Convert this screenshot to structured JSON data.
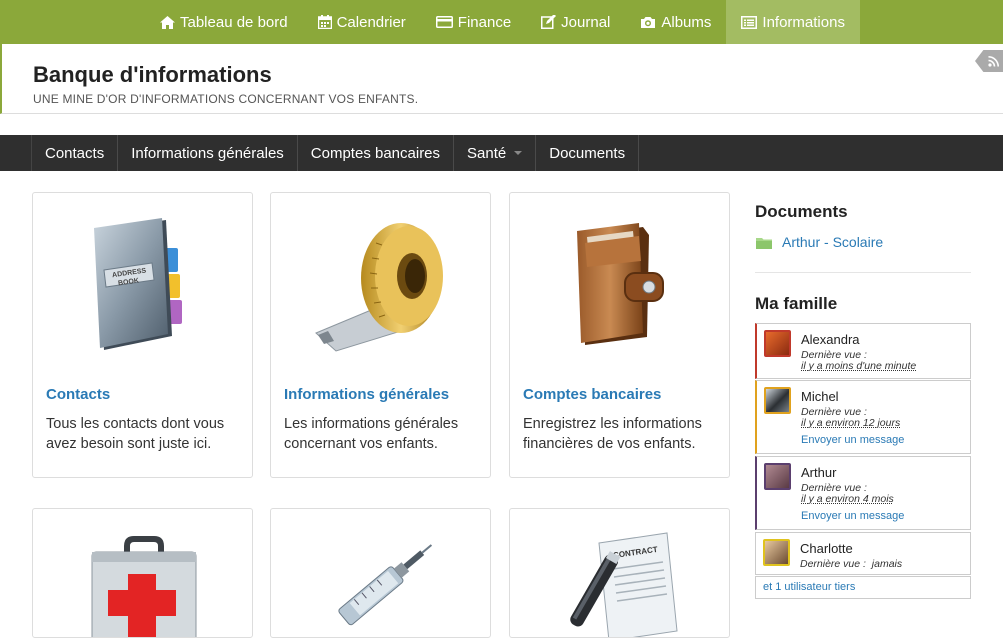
{
  "topnav": {
    "items": [
      {
        "label": "Tableau de bord",
        "icon": "home-icon"
      },
      {
        "label": "Calendrier",
        "icon": "calendar-icon"
      },
      {
        "label": "Finance",
        "icon": "credit-card-icon"
      },
      {
        "label": "Journal",
        "icon": "edit-icon"
      },
      {
        "label": "Albums",
        "icon": "camera-icon"
      },
      {
        "label": "Informations",
        "icon": "list-icon"
      }
    ],
    "active_index": 5
  },
  "header": {
    "title": "Banque d'informations",
    "subtitle": "UNE MINE D'OR D'INFORMATIONS CONCERNANT VOS ENFANTS."
  },
  "subnav": {
    "items": [
      "Contacts",
      "Informations générales",
      "Comptes bancaires",
      "Santé",
      "Documents"
    ]
  },
  "cards": [
    {
      "title": "Contacts",
      "desc": "Tous les contacts dont vous avez besoin sont juste ici.",
      "icon": "address-book-icon"
    },
    {
      "title": "Informations générales",
      "desc": "Les informations générales concernant vos enfants.",
      "icon": "measuring-tape-icon"
    },
    {
      "title": "Comptes bancaires",
      "desc": "Enregistrez les informations financières de vos enfants.",
      "icon": "wallet-icon"
    },
    {
      "title": "",
      "desc": "",
      "icon": "first-aid-kit-icon"
    },
    {
      "title": "",
      "desc": "",
      "icon": "syringe-icon"
    },
    {
      "title": "",
      "desc": "",
      "icon": "contract-pen-icon"
    }
  ],
  "sidebar": {
    "documents_heading": "Documents",
    "document_link": "Arthur - Scolaire",
    "family_heading": "Ma famille",
    "last_seen_label": "Dernière vue :",
    "message_label": "Envoyer un message",
    "members": [
      {
        "name": "Alexandra",
        "last_seen": "il y a moins d'une minute",
        "color": "#c0392b"
      },
      {
        "name": "Michel",
        "last_seen": "il y a environ 12 jours",
        "color": "#e0a21e"
      },
      {
        "name": "Arthur",
        "last_seen": "il y a environ 4 mois",
        "color": "#5b3f6e"
      },
      {
        "name": "Charlotte",
        "last_seen": "jamais",
        "color": "#e0c31e"
      }
    ],
    "tiers": "et 1 utilisateur tiers"
  }
}
